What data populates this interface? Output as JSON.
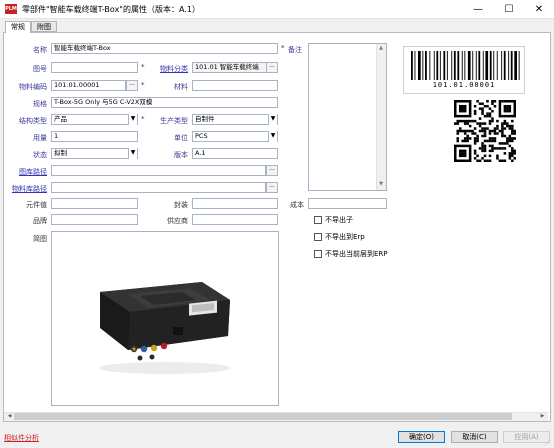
{
  "window": {
    "title": "零部件\"智能车载终端T-Box\"的属性（版本：A.1）",
    "app_icon_text": "PLM",
    "minimize": "—",
    "maximize": "☐",
    "close": "✕"
  },
  "tabs": [
    {
      "label": "常规",
      "active": true
    },
    {
      "label": "附图",
      "active": false
    }
  ],
  "form": {
    "name": {
      "label": "名称",
      "value": "智能车载终端T-Box"
    },
    "note": {
      "label": "备注",
      "value": ""
    },
    "drawing_no": {
      "label": "图号",
      "value": ""
    },
    "material_category": {
      "label": "物料分类",
      "value": "101.01 智能车载终端"
    },
    "material_code": {
      "label": "物料编码",
      "value": "101.01.00001"
    },
    "material": {
      "label": "材料",
      "value": ""
    },
    "spec": {
      "label": "规格",
      "value": "T-Box-5G Only 与5G C-V2X双模"
    },
    "structure_type": {
      "label": "结构类型",
      "value": "产品"
    },
    "production_type": {
      "label": "生产类型",
      "value": "自制件"
    },
    "quantity": {
      "label": "用量",
      "value": "1"
    },
    "unit": {
      "label": "单位",
      "value": "PCS"
    },
    "status": {
      "label": "状态",
      "value": "拟制"
    },
    "version": {
      "label": "版本",
      "value": "A.1"
    },
    "drawing_path": {
      "label": "图库路径",
      "value": ""
    },
    "material_path": {
      "label": "物料库路径",
      "value": ""
    },
    "component_value": {
      "label": "元件值",
      "value": ""
    },
    "package": {
      "label": "封装",
      "value": ""
    },
    "cost": {
      "label": "成本",
      "value": ""
    },
    "brand": {
      "label": "品牌",
      "value": ""
    },
    "supplier": {
      "label": "供应商",
      "value": ""
    },
    "sketch": {
      "label": "简图"
    },
    "required_mark": "*",
    "dropdown_glyph": "▼",
    "browse_glyph": "..."
  },
  "checkboxes": [
    {
      "label": "不导出子",
      "checked": false
    },
    {
      "label": "不导出到Erp",
      "checked": false
    },
    {
      "label": "不导出当前层到ERP",
      "checked": false
    }
  ],
  "barcode_text": "101.01.00001",
  "footer": {
    "link": "相似件分析",
    "ok": "确定(O)",
    "cancel": "取消(C)",
    "apply": "应用(A)"
  }
}
